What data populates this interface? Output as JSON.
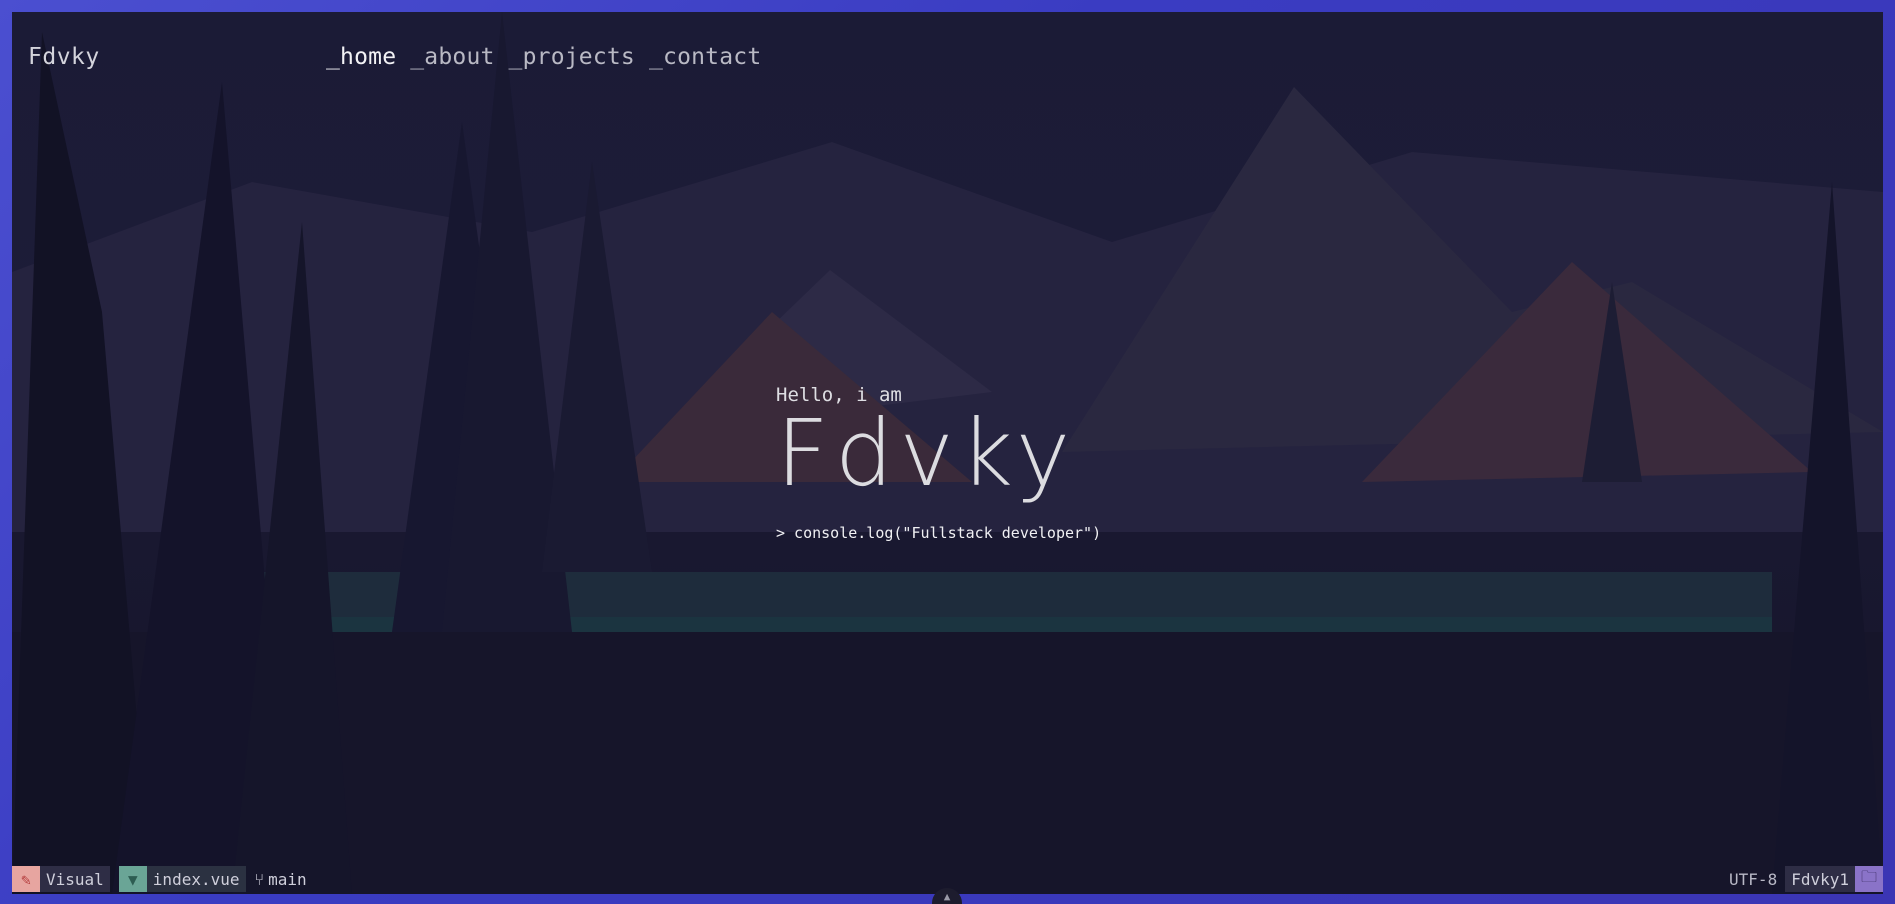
{
  "nav": {
    "brand": "Fdvky",
    "items": [
      {
        "label": "_home",
        "active": true
      },
      {
        "label": "_about",
        "active": false
      },
      {
        "label": "_projects",
        "active": false
      },
      {
        "label": "_contact",
        "active": false
      }
    ]
  },
  "hero": {
    "greeting": "Hello, i am",
    "name": "Fdvky",
    "command": "> console.log(\"Fullstack developer\")"
  },
  "statusbar": {
    "mode": {
      "label": "Visual",
      "icon": "brush-icon"
    },
    "file": {
      "label": "index.vue",
      "icon": "vue-icon"
    },
    "branch": {
      "label": "main",
      "icon": "git-branch-icon"
    },
    "encoding": "UTF-8",
    "user": "Fdvky1",
    "folder_icon": "folder-icon"
  },
  "colors": {
    "background_accent": "#3a3cc2",
    "mode_accent": "#e7a5a0",
    "file_accent": "#6aa596",
    "folder_accent": "#8a73c8"
  }
}
